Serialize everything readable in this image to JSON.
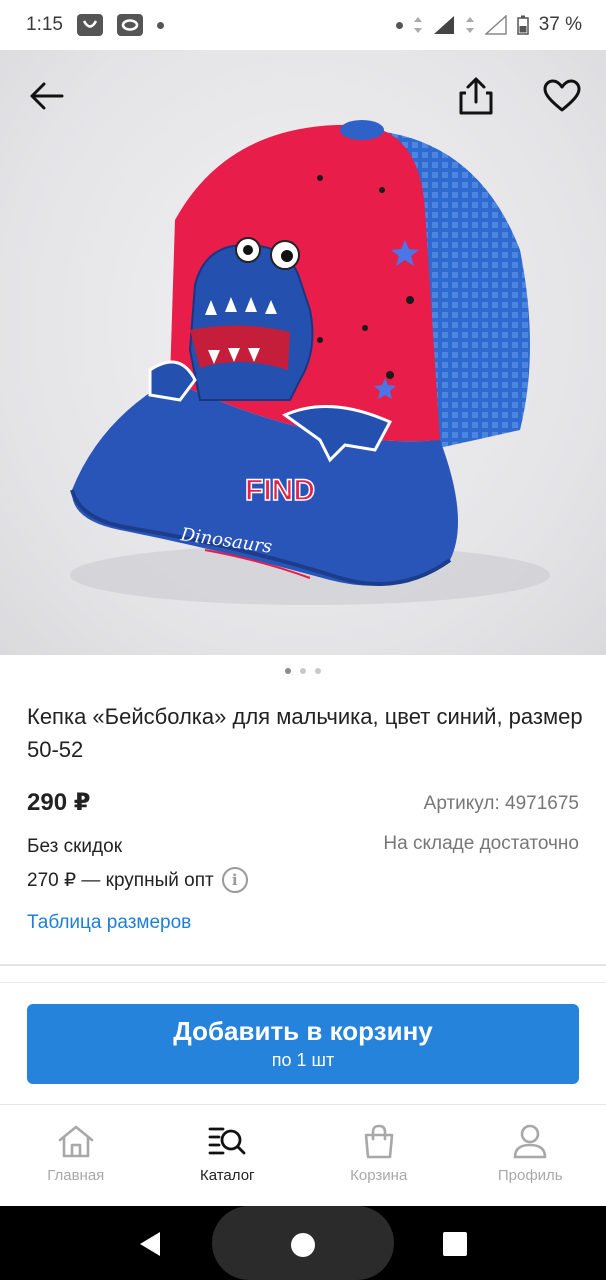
{
  "status_bar": {
    "time": "1:15",
    "battery": "37 %"
  },
  "product": {
    "title": "Кепка «Бейсболка» для мальчика, цвет синий, размер 50-52",
    "price": "290 ₽",
    "sku": "Артикул: 4971675",
    "discount": "Без скидок",
    "stock": "На складе достаточно",
    "wholesale": "270 ₽ — крупный опт",
    "size_table": "Таблица размеров",
    "image_cap_text": "FIND",
    "image_cap_text2": "Dinosaurs"
  },
  "gallery": {
    "count": 3,
    "active": 0
  },
  "cart_button": {
    "label": "Добавить в корзину",
    "sub": "по 1 шт"
  },
  "bottom_nav": {
    "items": [
      {
        "label": "Главная",
        "icon": "home-icon"
      },
      {
        "label": "Каталог",
        "icon": "catalog-search-icon",
        "active": true
      },
      {
        "label": "Корзина",
        "icon": "bag-icon"
      },
      {
        "label": "Профиль",
        "icon": "profile-icon"
      }
    ]
  },
  "colors": {
    "accent": "#2683dc",
    "link": "#1e7fd4"
  }
}
